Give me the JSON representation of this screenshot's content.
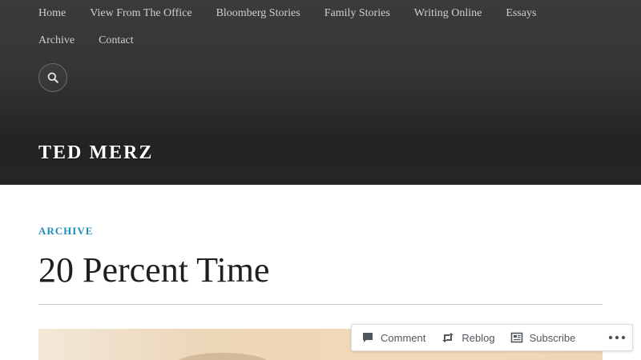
{
  "nav": {
    "row1": [
      "Home",
      "View From The Office",
      "Bloomberg Stories",
      "Family Stories",
      "Writing Online",
      "Essays"
    ],
    "row2": [
      "Archive",
      "Contact"
    ]
  },
  "site": {
    "title": "TED MERZ"
  },
  "post": {
    "category": "ARCHIVE",
    "title": "20 Percent Time"
  },
  "actions": {
    "comment": "Comment",
    "reblog": "Reblog",
    "subscribe": "Subscribe"
  },
  "colors": {
    "header_bg": "#2c2c2c",
    "nav_text": "#cfcfcf",
    "category": "#1e8cbe",
    "title_text": "#1f1f1f"
  },
  "icons": {
    "search": "search-icon",
    "comment": "comment-icon",
    "reblog": "reblog-icon",
    "subscribe": "subscribe-icon",
    "more": "more-horizontal-icon"
  }
}
